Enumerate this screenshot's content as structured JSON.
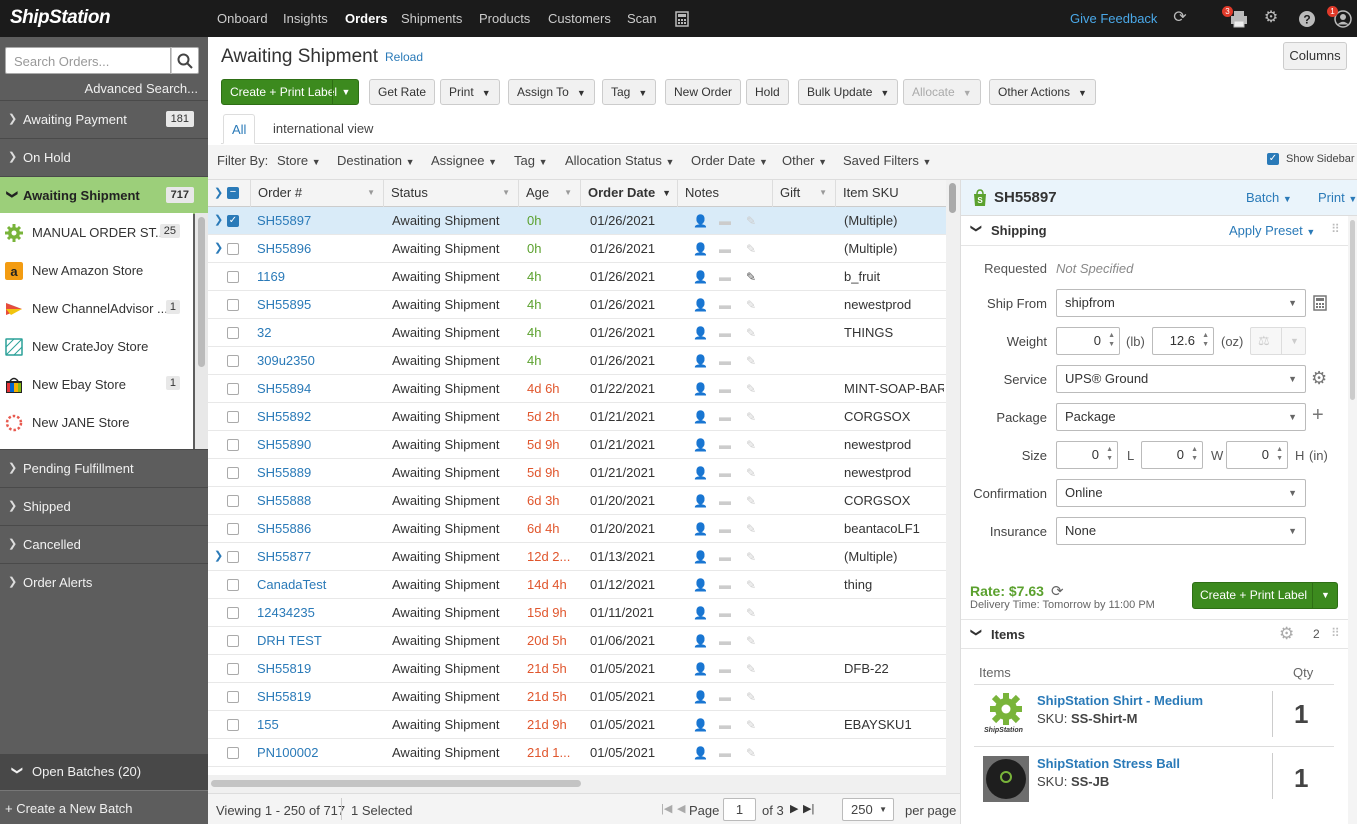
{
  "topnav": {
    "logo": "ShipStation",
    "links": [
      "Onboard",
      "Insights",
      "Orders",
      "Shipments",
      "Products",
      "Customers",
      "Scan"
    ],
    "active": "Orders",
    "feedback": "Give Feedback",
    "print_badge": "3",
    "profile_badge": "1"
  },
  "sidebar": {
    "search_placeholder": "Search Orders...",
    "advanced_search": "Advanced Search...",
    "groups": [
      {
        "label": "Awaiting Payment",
        "count": "181"
      },
      {
        "label": "On Hold",
        "count": ""
      },
      {
        "label": "Awaiting Shipment",
        "count": "717"
      }
    ],
    "stores": [
      {
        "label": "MANUAL ORDER ST...",
        "count": "25",
        "icon": "gear-icon"
      },
      {
        "label": "New Amazon Store",
        "count": "",
        "icon": "amazon-icon"
      },
      {
        "label": "New ChannelAdvisor ...",
        "count": "1",
        "icon": "channeladvisor-icon"
      },
      {
        "label": "New CrateJoy Store",
        "count": "",
        "icon": "cratejoy-icon"
      },
      {
        "label": "New Ebay Store",
        "count": "1",
        "icon": "ebay-icon"
      },
      {
        "label": "New JANE Store",
        "count": "",
        "icon": "jane-icon"
      }
    ],
    "lower_groups": [
      "Pending Fulfillment",
      "Shipped",
      "Cancelled",
      "Order Alerts"
    ],
    "open_batches": "Open Batches (20)",
    "create_batch": "+ Create a New Batch"
  },
  "header": {
    "title": "Awaiting Shipment",
    "reload": "Reload",
    "columns": "Columns",
    "create_print": "Create + Print Label",
    "buttons": [
      "Get Rate",
      "Print",
      "Assign To",
      "Tag",
      "New Order",
      "Hold",
      "Bulk Update",
      "Allocate",
      "Other Actions"
    ],
    "tabs": [
      "All",
      "international view"
    ]
  },
  "filters": {
    "label": "Filter By:",
    "items": [
      "Store",
      "Destination",
      "Assignee",
      "Tag",
      "Allocation Status",
      "Order Date",
      "Other",
      "Saved Filters"
    ],
    "show_sidebar": "Show Sidebar"
  },
  "table": {
    "columns": [
      "Order #",
      "Status",
      "Age",
      "Order Date",
      "Notes",
      "Gift",
      "Item SKU"
    ],
    "rows": [
      {
        "order": "SH55897",
        "status": "Awaiting Shipment",
        "age": "0h",
        "age_color": "green",
        "date": "01/26/2021",
        "sku": "(Multiple)",
        "expand": true,
        "checked": true,
        "note_user": false,
        "note_edit": false
      },
      {
        "order": "SH55896",
        "status": "Awaiting Shipment",
        "age": "0h",
        "age_color": "green",
        "date": "01/26/2021",
        "sku": "(Multiple)",
        "expand": true,
        "checked": false,
        "note_user": false,
        "note_edit": false
      },
      {
        "order": "1169",
        "status": "Awaiting Shipment",
        "age": "4h",
        "age_color": "green",
        "date": "01/26/2021",
        "sku": "b_fruit",
        "expand": false,
        "checked": false,
        "note_user": false,
        "note_edit": true
      },
      {
        "order": "SH55895",
        "status": "Awaiting Shipment",
        "age": "4h",
        "age_color": "green",
        "date": "01/26/2021",
        "sku": "newestprod",
        "expand": false,
        "checked": false,
        "note_user": false,
        "note_edit": false
      },
      {
        "order": "32",
        "status": "Awaiting Shipment",
        "age": "4h",
        "age_color": "green",
        "date": "01/26/2021",
        "sku": "THINGS",
        "expand": false,
        "checked": false,
        "note_user": false,
        "note_edit": false
      },
      {
        "order": "309u2350",
        "status": "Awaiting Shipment",
        "age": "4h",
        "age_color": "green",
        "date": "01/26/2021",
        "sku": "",
        "expand": false,
        "checked": false,
        "note_user": false,
        "note_edit": false
      },
      {
        "order": "SH55894",
        "status": "Awaiting Shipment",
        "age": "4d 6h",
        "age_color": "red",
        "date": "01/22/2021",
        "sku": "MINT-SOAP-BAR",
        "expand": false,
        "checked": false,
        "note_user": false,
        "note_edit": false
      },
      {
        "order": "SH55892",
        "status": "Awaiting Shipment",
        "age": "5d 2h",
        "age_color": "red",
        "date": "01/21/2021",
        "sku": "CORGSOX",
        "expand": false,
        "checked": false,
        "note_user": false,
        "note_edit": false
      },
      {
        "order": "SH55890",
        "status": "Awaiting Shipment",
        "age": "5d 9h",
        "age_color": "red",
        "date": "01/21/2021",
        "sku": "newestprod",
        "expand": false,
        "checked": false,
        "note_user": false,
        "note_edit": false
      },
      {
        "order": "SH55889",
        "status": "Awaiting Shipment",
        "age": "5d 9h",
        "age_color": "red",
        "date": "01/21/2021",
        "sku": "newestprod",
        "expand": false,
        "checked": false,
        "note_user": false,
        "note_edit": false
      },
      {
        "order": "SH55888",
        "status": "Awaiting Shipment",
        "age": "6d 3h",
        "age_color": "red",
        "date": "01/20/2021",
        "sku": "CORGSOX",
        "expand": false,
        "checked": false,
        "note_user": true,
        "note_edit": false
      },
      {
        "order": "SH55886",
        "status": "Awaiting Shipment",
        "age": "6d 4h",
        "age_color": "red",
        "date": "01/20/2021",
        "sku": "beantacoLF1",
        "expand": false,
        "checked": false,
        "note_user": false,
        "note_edit": false
      },
      {
        "order": "SH55877",
        "status": "Awaiting Shipment",
        "age": "12d 2...",
        "age_color": "red",
        "date": "01/13/2021",
        "sku": "(Multiple)",
        "expand": true,
        "checked": false,
        "note_user": true,
        "note_edit": false
      },
      {
        "order": "CanadaTest",
        "status": "Awaiting Shipment",
        "age": "14d 4h",
        "age_color": "red",
        "date": "01/12/2021",
        "sku": "thing",
        "expand": false,
        "checked": false,
        "note_user": false,
        "note_edit": false
      },
      {
        "order": "12434235",
        "status": "Awaiting Shipment",
        "age": "15d 9h",
        "age_color": "red",
        "date": "01/11/2021",
        "sku": "",
        "expand": false,
        "checked": false,
        "note_user": false,
        "note_edit": false
      },
      {
        "order": "DRH TEST",
        "status": "Awaiting Shipment",
        "age": "20d 5h",
        "age_color": "red",
        "date": "01/06/2021",
        "sku": "",
        "expand": false,
        "checked": false,
        "note_user": false,
        "note_edit": false
      },
      {
        "order": "SH55819",
        "status": "Awaiting Shipment",
        "age": "21d 5h",
        "age_color": "red",
        "date": "01/05/2021",
        "sku": "DFB-22",
        "expand": false,
        "checked": false,
        "note_user": false,
        "note_edit": false
      },
      {
        "order": "SH55819",
        "status": "Awaiting Shipment",
        "age": "21d 5h",
        "age_color": "red",
        "date": "01/05/2021",
        "sku": "",
        "expand": false,
        "checked": false,
        "note_user": false,
        "note_edit": false
      },
      {
        "order": "155",
        "status": "Awaiting Shipment",
        "age": "21d 9h",
        "age_color": "red",
        "date": "01/05/2021",
        "sku": "EBAYSKU1",
        "expand": false,
        "checked": false,
        "note_user": false,
        "note_edit": false
      },
      {
        "order": "PN100002",
        "status": "Awaiting Shipment",
        "age": "21d 1...",
        "age_color": "red",
        "date": "01/05/2021",
        "sku": "",
        "expand": false,
        "checked": false,
        "note_user": false,
        "note_edit": false
      }
    ]
  },
  "footer": {
    "viewing": "Viewing 1 - 250 of 717",
    "selected": "1 Selected",
    "page_label": "Page",
    "page_value": "1",
    "of_pages": "of 3",
    "per_page_value": "250",
    "per_page": "per page"
  },
  "panel": {
    "order": "SH55897",
    "batch": "Batch",
    "print": "Print",
    "shipping": {
      "title": "Shipping",
      "apply_preset": "Apply Preset",
      "requested_label": "Requested",
      "requested_value": "Not Specified",
      "ship_from_label": "Ship From",
      "ship_from_value": "shipfrom",
      "weight_label": "Weight",
      "weight_lb": "0",
      "lb": "(lb)",
      "weight_oz": "12.6",
      "oz": "(oz)",
      "service_label": "Service",
      "service_value": "UPS® Ground",
      "package_label": "Package",
      "package_value": "Package",
      "size_label": "Size",
      "size_l": "0",
      "size_w": "0",
      "size_h": "0",
      "l": "L",
      "w": "W",
      "h": "H",
      "in": "(in)",
      "confirmation_label": "Confirmation",
      "confirmation_value": "Online",
      "insurance_label": "Insurance",
      "insurance_value": "None"
    },
    "rate": "Rate: $7.63",
    "delivery": "Delivery Time: Tomorrow by 11:00 PM",
    "create_print": "Create + Print Label",
    "items": {
      "title": "Items",
      "count": "2",
      "col_items": "Items",
      "col_qty": "Qty",
      "list": [
        {
          "name": "ShipStation Shirt - Medium",
          "sku_label": "SKU:",
          "sku": "SS-Shirt-M",
          "qty": "1",
          "logo_text": "ShipStation"
        },
        {
          "name": "ShipStation Stress Ball",
          "sku_label": "SKU:",
          "sku": "SS-JB",
          "qty": "1"
        }
      ]
    }
  },
  "colors": {
    "accent": "#2a7ab8",
    "green": "#3c8a1e",
    "active_group": "#9ccf7a",
    "age_red": "#e0562d",
    "age_green": "#5ba12e"
  }
}
